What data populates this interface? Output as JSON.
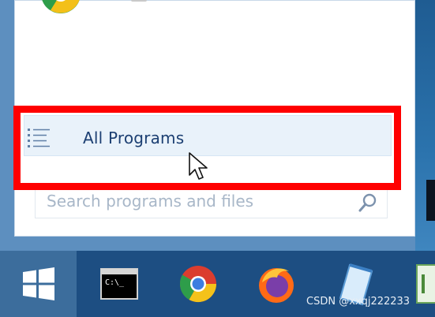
{
  "start_menu": {
    "all_programs_label": "All Programs",
    "search_placeholder": "Search programs and files"
  },
  "taskbar": {
    "items": [
      {
        "icon": "windows-start-icon"
      },
      {
        "icon": "command-prompt-icon"
      },
      {
        "icon": "chrome-icon"
      },
      {
        "icon": "firefox-icon"
      },
      {
        "icon": "notepad-icon"
      },
      {
        "icon": "app-icon"
      }
    ]
  },
  "watermark": "CSDN @xxqj222233",
  "colors": {
    "highlight": "#ff0000",
    "taskbar": "#1d4e82",
    "start_button": "#3c6d9c",
    "all_programs_text": "#1c3f72"
  }
}
